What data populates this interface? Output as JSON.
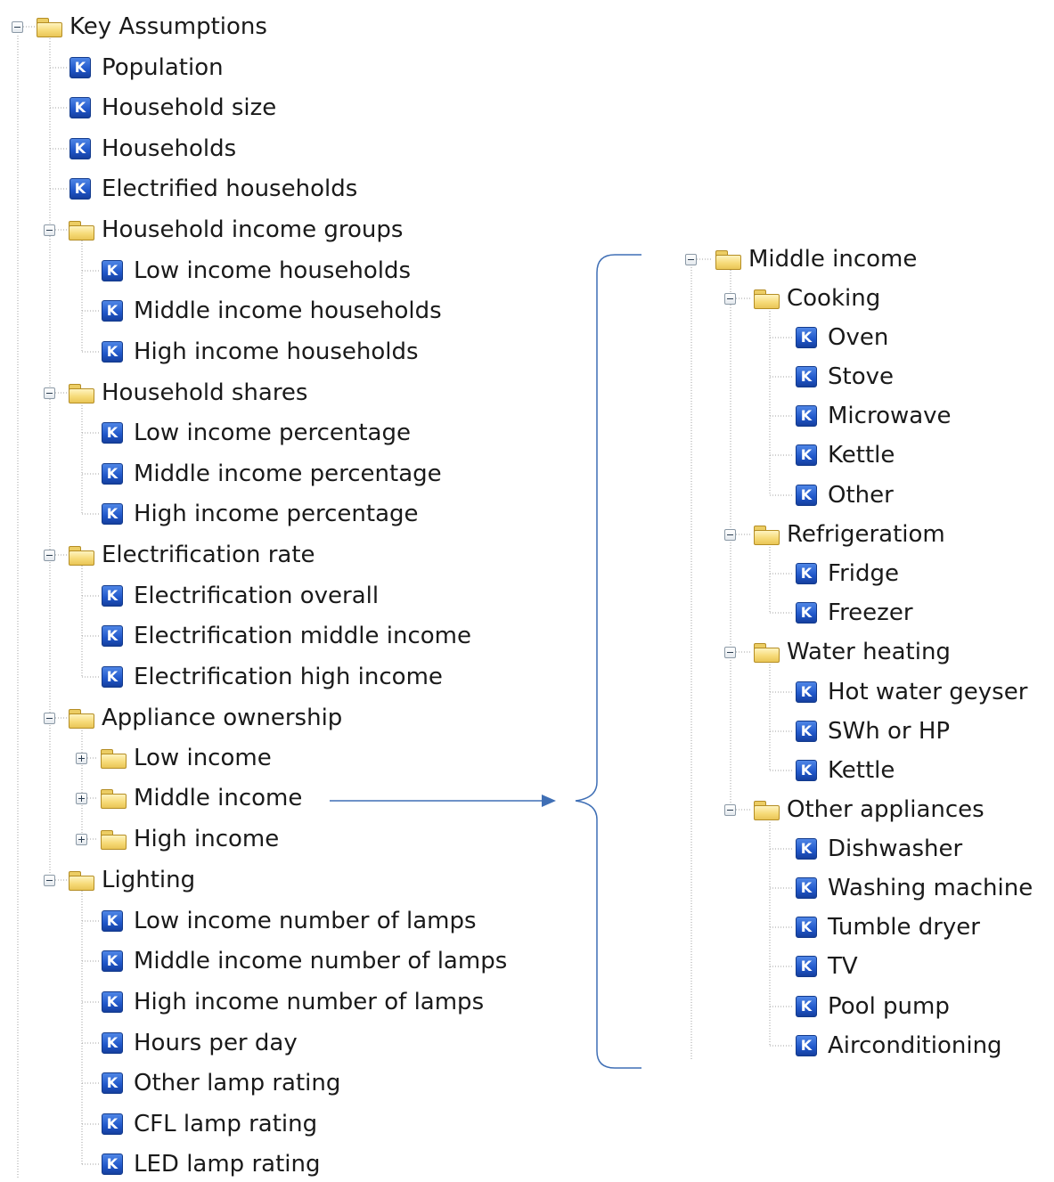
{
  "left_tree": {
    "root": "Key Assumptions",
    "items": {
      "population": "Population",
      "household_size": "Household size",
      "households": "Households",
      "electrified_households": "Electrified households",
      "household_income_groups": {
        "label": "Household income groups",
        "children": [
          "Low income households",
          "Middle income households",
          "High income households"
        ]
      },
      "household_shares": {
        "label": "Household shares",
        "children": [
          "Low income percentage",
          "Middle income percentage",
          "High income percentage"
        ]
      },
      "electrification_rate": {
        "label": "Electrification rate",
        "children": [
          "Electrification overall",
          "Electrification middle income",
          "Electrification high income"
        ]
      },
      "appliance_ownership": {
        "label": "Appliance ownership",
        "children": [
          "Low income",
          "Middle income",
          "High income"
        ]
      },
      "lighting": {
        "label": "Lighting",
        "children": [
          "Low income number of lamps",
          "Middle income number of lamps",
          "High income number of lamps",
          "Hours per day",
          "Other lamp rating",
          "CFL lamp rating",
          "LED lamp rating"
        ]
      }
    }
  },
  "right_tree": {
    "root": "Middle income",
    "groups": {
      "cooking": {
        "label": "Cooking",
        "children": [
          "Oven",
          "Stove",
          "Microwave",
          "Kettle",
          "Other"
        ]
      },
      "refrigeration": {
        "label": "Refrigeratiom",
        "children": [
          "Fridge",
          "Freezer"
        ]
      },
      "water_heating": {
        "label": "Water heating",
        "children": [
          "Hot water geyser",
          "SWh or HP",
          "Kettle"
        ]
      },
      "other_appliances": {
        "label": "Other appliances",
        "children": [
          "Dishwasher",
          "Washing machine",
          "Tumble dryer",
          "TV",
          "Pool pump",
          "Airconditioning"
        ]
      }
    }
  },
  "icons": {
    "key_letter": "K",
    "folder": "folder-icon",
    "expanded": "minus-toggle",
    "collapsed": "plus-toggle"
  },
  "colors": {
    "key_icon": "#1f56c9",
    "folder": "#f6db79",
    "connector": "#3f6fb5",
    "tree_lines": "#a0a0a0"
  }
}
